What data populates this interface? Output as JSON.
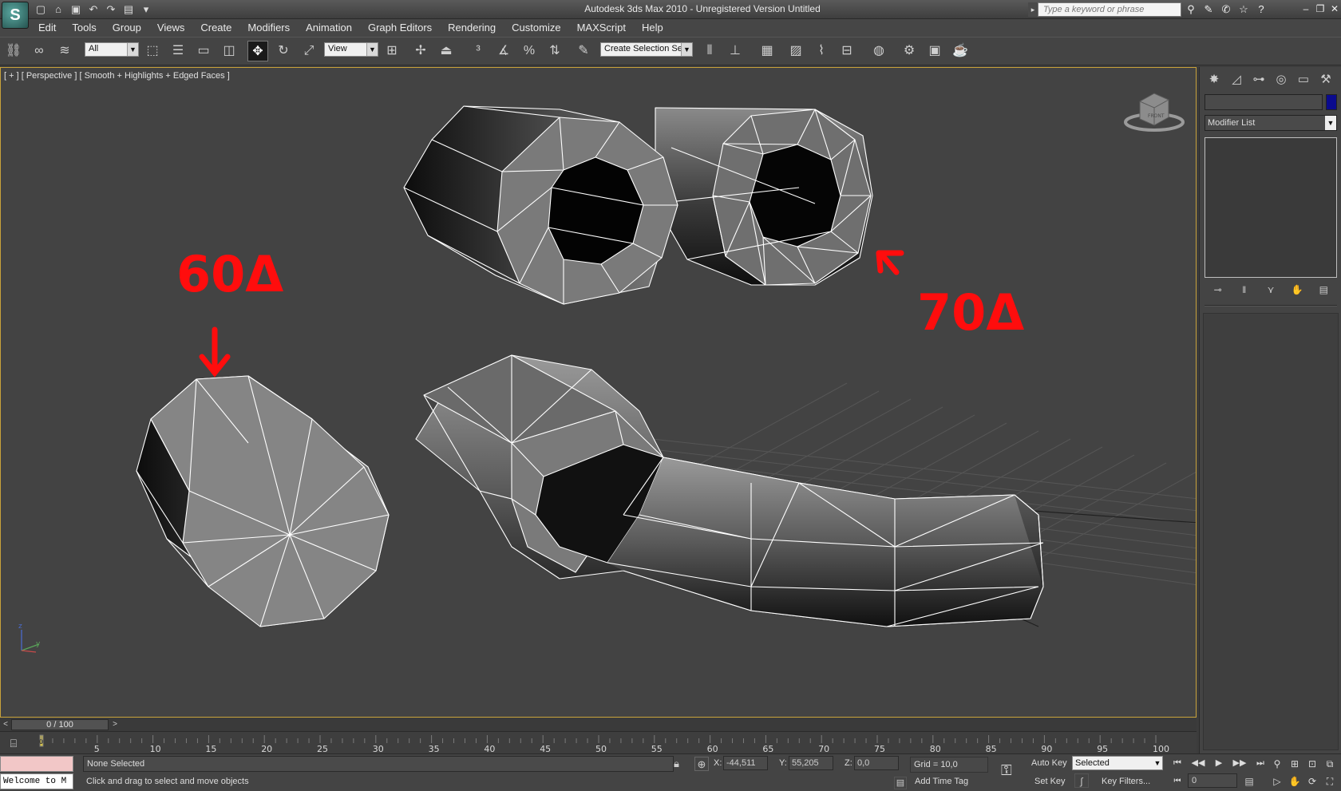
{
  "titlebar": {
    "title": "Autodesk 3ds Max  2010   - Unregistered Version    Untitled",
    "search_placeholder": "Type a keyword or phrase",
    "logo_glyph": "S"
  },
  "menu": {
    "items": [
      "Edit",
      "Tools",
      "Group",
      "Views",
      "Create",
      "Modifiers",
      "Animation",
      "Graph Editors",
      "Rendering",
      "Customize",
      "MAXScript",
      "Help"
    ]
  },
  "toolbar": {
    "selection_filter": "All",
    "ref_coord": "View",
    "named_selection": "Create Selection Se"
  },
  "viewport": {
    "label": "[ + ] [ Perspective ] [ Smooth + Highlights + Edged Faces ]",
    "annotation_60": "60Δ",
    "annotation_70": "70Δ",
    "viewcube_text": "FRONT",
    "axis_z": "z",
    "axis_y": "y",
    "annotation_color": "#ff0d0d"
  },
  "command_panel": {
    "modifier_list": "Modifier List",
    "object_color": "#0a0a8e"
  },
  "time_slider": {
    "position": "0 / 100",
    "ticks": [
      "5",
      "10",
      "15",
      "20",
      "25",
      "30",
      "35",
      "40",
      "45",
      "50",
      "55",
      "60",
      "65",
      "70",
      "75",
      "80",
      "85",
      "90",
      "95",
      "100"
    ],
    "frame_zero": "0"
  },
  "status": {
    "maxscript_listener": "Welcome to M",
    "selection": "None Selected",
    "prompt": "Click and drag to select and move objects",
    "x_label": "X:",
    "x_value": "-44,511",
    "y_label": "Y:",
    "y_value": "55,205",
    "z_label": "Z:",
    "z_value": "0,0",
    "grid": "Grid = 10,0",
    "add_time_tag": "Add Time Tag",
    "auto_key": "Auto Key",
    "set_key": "Set Key",
    "selected_mode": "Selected",
    "key_filters": "Key Filters...",
    "current_frame": "0"
  }
}
